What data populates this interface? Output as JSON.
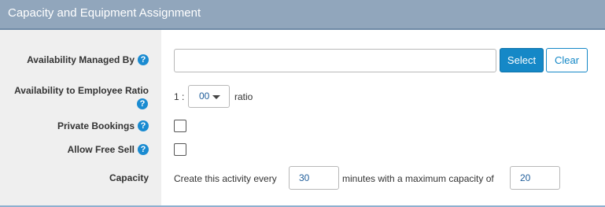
{
  "header": {
    "title": "Capacity and Equipment Assignment"
  },
  "rows": {
    "availability_managed_by": {
      "label": "Availability Managed By",
      "value": "",
      "select_label": "Select",
      "clear_label": "Clear"
    },
    "ratio": {
      "label_line1": "Availability to Employee Ratio",
      "prefix": "1 :",
      "value": "00",
      "suffix": "ratio"
    },
    "private_bookings": {
      "label": "Private Bookings",
      "checked": false
    },
    "allow_free_sell": {
      "label": "Allow Free Sell",
      "checked": false
    },
    "capacity": {
      "label": "Capacity",
      "text_before": "Create this activity every",
      "minutes_value": "30",
      "text_middle": "minutes with a maximum capacity of",
      "max_value": "20"
    }
  },
  "icons": {
    "help": "question-circle-icon",
    "dropdown": "caret-down-icon"
  },
  "colors": {
    "header_bg": "#91a6bc",
    "label_bg": "#efefef",
    "primary": "#1588c7",
    "help_icon": "#1a8bd1",
    "input_text": "#1f5d9a"
  }
}
